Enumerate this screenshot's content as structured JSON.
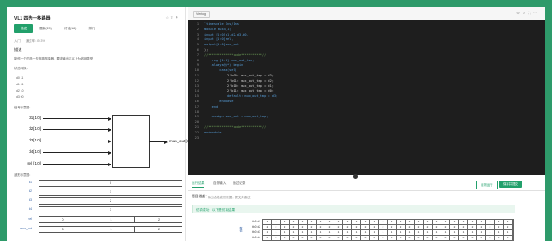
{
  "left": {
    "title": "VL1 四选一多路器",
    "icons": [
      "star-icon",
      "share-icon",
      "report-icon"
    ],
    "tabs": [
      "描述",
      "题解(20)",
      "讨论(18)",
      "排行"
    ],
    "breadcrumb": [
      "入门",
      "通过率: 49.3%"
    ],
    "desc_heading": "描述",
    "desc_text": "制作一个四选一的多路选择器，要求输出定义上为线网类型",
    "status_heading": "状态转换：",
    "examples": [
      "d0  11",
      "d1  01",
      "d2  10",
      "d3  00"
    ],
    "signal_heading": "信号示意图：",
    "diagram": {
      "inputs": [
        "d1[1:0]",
        "d2[1:0]",
        "d3[1:0]",
        "d4[1:0]",
        "sel [1:0]"
      ],
      "output": "mux_out [1:0]"
    },
    "wave_heading": "波形示意图：",
    "wave": {
      "rows": [
        {
          "name": "d1",
          "value": "0"
        },
        {
          "name": "d2",
          "value": "1"
        },
        {
          "name": "d3",
          "value": "2"
        },
        {
          "name": "d4",
          "value": "3"
        }
      ],
      "sel": {
        "name": "sel",
        "values": [
          "0",
          "1",
          "2"
        ]
      },
      "mux": {
        "name": "mux_out",
        "values": [
          "3",
          "1",
          "2"
        ]
      }
    }
  },
  "right": {
    "language": "Verilog",
    "toolbar_icons": [
      "settings-icon",
      "reset-icon",
      "fullscreen-icon",
      "more-icon"
    ],
    "code_lines": [
      {
        "n": "1",
        "t": "`timescale 1ns/1ns"
      },
      {
        "n": "2",
        "t": "module mux4_1("
      },
      {
        "n": "3",
        "t": "input [1:0]d1,d2,d3,d0,"
      },
      {
        "n": "4",
        "t": "input [1:0]sel,"
      },
      {
        "n": "5",
        "t": "output[1:0]mux_out"
      },
      {
        "n": "6",
        "t": ");"
      },
      {
        "n": "7",
        "t": "//*************code***********//"
      },
      {
        "n": "8",
        "t": "    reg [1:0] mux_out_tmp;"
      },
      {
        "n": "9",
        "t": "    always@(*) begin"
      },
      {
        "n": "10",
        "t": "        case(sel)"
      },
      {
        "n": "11",
        "t": "            2'b00: mux_out_tmp = d3;"
      },
      {
        "n": "12",
        "t": "            2'b01: mux_out_tmp = d2;"
      },
      {
        "n": "13",
        "t": "            2'b10: mux_out_tmp = d1;"
      },
      {
        "n": "14",
        "t": "            2'b11: mux_out_tmp = d0;"
      },
      {
        "n": "15",
        "t": "            default: mux_out_tmp = d3;"
      },
      {
        "n": "16",
        "t": "        endcase"
      },
      {
        "n": "17",
        "t": "    end"
      },
      {
        "n": "18",
        "t": ""
      },
      {
        "n": "19",
        "t": "    assign mux_out = mux_out_tmp;"
      },
      {
        "n": "20",
        "t": ""
      },
      {
        "n": "21",
        "t": "//*************code***********//"
      },
      {
        "n": "22",
        "t": "endmodule"
      },
      {
        "n": "23",
        "t": ""
      }
    ],
    "bottom_tabs": [
      "运行结果",
      "自测输入",
      "通过记录"
    ],
    "run_label": "自测运行",
    "submit_label": "保存并提交",
    "result_label": "题目描述：",
    "result_sub": "输出合格波形数据，提交并通过",
    "result_box": "仿真成功，以下是仿真结果",
    "sim_axis": "数值",
    "sim_rows": [
      {
        "name": "tb0 d1",
        "cells": [
          "3",
          "3",
          "3",
          "3",
          "3",
          "3",
          "3",
          "3",
          "3",
          "3",
          "3",
          "3",
          "3",
          "3",
          "3",
          "3",
          "3",
          "3",
          "3",
          "3",
          "3",
          "3",
          "3",
          "3",
          "3",
          "3",
          "3",
          "3"
        ]
      },
      {
        "name": "tb0 d2",
        "cells": [
          "2",
          "2",
          "2",
          "2",
          "2",
          "2",
          "2",
          "2",
          "2",
          "2",
          "2",
          "2",
          "2",
          "2",
          "2",
          "2",
          "2",
          "2",
          "2",
          "2",
          "2",
          "2",
          "2",
          "2",
          "2",
          "2",
          "2",
          "2"
        ]
      },
      {
        "name": "tb0 d3",
        "cells": [
          "1",
          "1",
          "1",
          "1",
          "1",
          "1",
          "1",
          "1",
          "1",
          "1",
          "1",
          "1",
          "1",
          "1",
          "1",
          "1",
          "1",
          "1",
          "1",
          "1",
          "1",
          "1",
          "1",
          "1",
          "1",
          "1",
          "1",
          "1"
        ]
      },
      {
        "name": "tb0 d4",
        "cells": [
          "0",
          "0",
          "0",
          "0",
          "0",
          "0",
          "0",
          "0",
          "0",
          "0",
          "0",
          "0",
          "0",
          "0",
          "0",
          "0",
          "0",
          "0",
          "0",
          "0",
          "0",
          "0",
          "0",
          "0",
          "0",
          "0",
          "0",
          "0"
        ]
      }
    ]
  }
}
